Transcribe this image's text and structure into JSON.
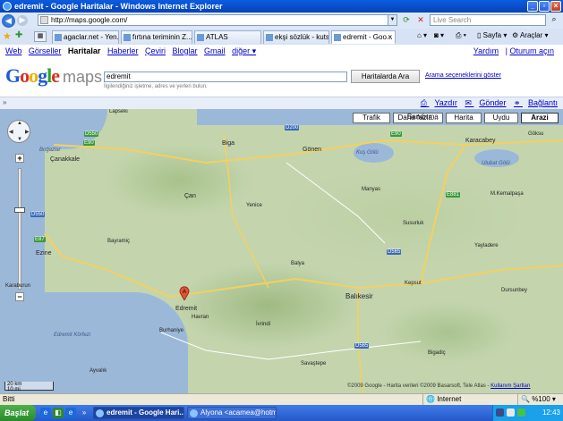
{
  "window": {
    "title": "edremit - Google Haritalar - Windows Internet Explorer"
  },
  "address": {
    "url": "http://maps.google.com/"
  },
  "livesearch": {
    "placeholder": "Live Search"
  },
  "tabs": [
    {
      "label": "agaclar.net - Yen..."
    },
    {
      "label": "fırtına teriminin Z..."
    },
    {
      "label": "ATLAS"
    },
    {
      "label": "ekşi sözlük - kuts..."
    },
    {
      "label": "edremit - Goo..."
    }
  ],
  "toolbar": {
    "page": "Sayfa",
    "tools": "Araçlar"
  },
  "gnav": {
    "links": [
      "Web",
      "Görseller",
      "Haritalar",
      "Haberler",
      "Çeviri",
      "Bloglar",
      "Gmail",
      "diğer ▾"
    ],
    "help": "Yardım",
    "signin": "Oturum açın"
  },
  "search": {
    "logo_google": "Google",
    "logo_maps": "maps",
    "query": "edremit",
    "hint": "İlgilendiğiniz işletme, adres ve yerleri bulun.",
    "button": "Haritalarda Ara",
    "options": "Arama seçeneklerini göster"
  },
  "maplinks": {
    "print": "Yazdır",
    "send": "Gönder",
    "link": "Bağlantı"
  },
  "map": {
    "types": [
      "Trafik",
      "Daha fazla...",
      "Harita",
      "Uydu",
      "Arazi"
    ],
    "selected_type": "Arazi",
    "marker": "A",
    "scale": "20 km",
    "scale2": "10 mi",
    "copyright": "©2009 Google - Harita verileri ©2009 Basarsoft, Tele Atlas -",
    "copyright_link": "Kullanım Şartları",
    "labels": {
      "lapseki": "Lapseki",
      "canakkale": "Çanakkale",
      "bogaz": "Boğazlar",
      "biga": "Biga",
      "bandirma": "Bandırma",
      "karacabey": "Karacabey",
      "gonen": "Gönen",
      "manyas": "Manyas",
      "kusgolu": "Kuş Gölü",
      "ulubatgolu": "Ulubat Gölü",
      "can": "Çan",
      "yenice": "Yenice",
      "ezine": "Ezine",
      "bayramic": "Bayramiç",
      "balya": "Balya",
      "balikesir": "Balıkesir",
      "susurluk": "Susurluk",
      "edremit": "Edremit",
      "havran": "Havran",
      "burhaniye": "Burhaniye",
      "ayvalik": "Ayvalık",
      "ivrindi": "İvrindi",
      "savastepe": "Savaştepe",
      "kepsut": "Kepsut",
      "bigadic": "Bigadiç",
      "goksu": "Göksu",
      "karaburun": "Karaburun",
      "gokce": "Gökçe",
      "dursunbey": "Dursunbey",
      "mustafakemal": "M.Kemalpaşa",
      "yayladere": "Yayladere",
      "korfez": "Edremit Körfezi"
    }
  },
  "status": {
    "left": "Bitti",
    "zone": "Internet",
    "zoom": "%100"
  },
  "taskbar": {
    "start": "Başlat",
    "tasks": [
      "edremit - Google Hari...",
      "Alyona <acamea@hotm..."
    ],
    "time": "12:43"
  }
}
